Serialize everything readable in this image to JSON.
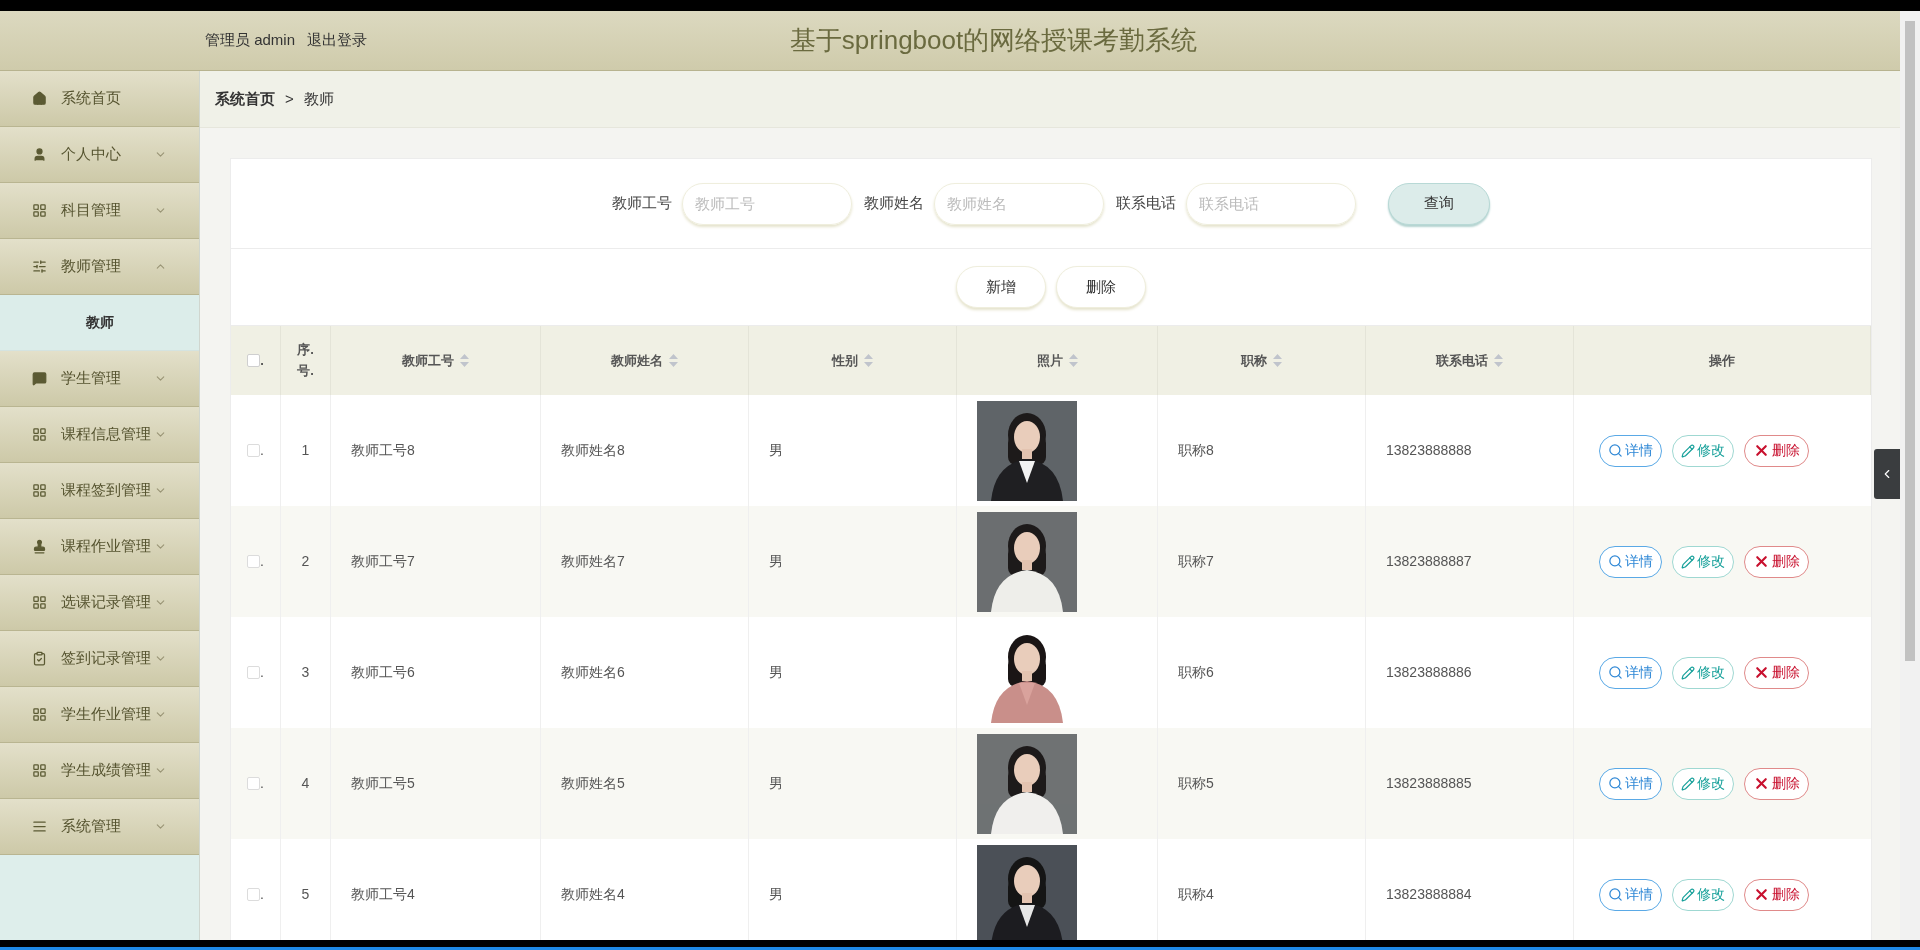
{
  "header": {
    "user_label": "管理员 admin",
    "logout": "退出登录",
    "title": "基于springboot的网络授课考勤系统"
  },
  "sidebar": {
    "items": [
      {
        "label": "系统首页",
        "kind": "link"
      },
      {
        "label": "个人中心",
        "kind": "menu",
        "expanded": false
      },
      {
        "label": "科目管理",
        "kind": "menu",
        "expanded": false
      },
      {
        "label": "教师管理",
        "kind": "menu",
        "expanded": true,
        "children": [
          {
            "label": "教师",
            "selected": true
          }
        ]
      },
      {
        "label": "学生管理",
        "kind": "menu",
        "expanded": false
      },
      {
        "label": "课程信息管理",
        "kind": "menu",
        "expanded": false
      },
      {
        "label": "课程签到管理",
        "kind": "menu",
        "expanded": false
      },
      {
        "label": "课程作业管理",
        "kind": "menu",
        "expanded": false
      },
      {
        "label": "选课记录管理",
        "kind": "menu",
        "expanded": false
      },
      {
        "label": "签到记录管理",
        "kind": "menu",
        "expanded": false
      },
      {
        "label": "学生作业管理",
        "kind": "menu",
        "expanded": false
      },
      {
        "label": "学生成绩管理",
        "kind": "menu",
        "expanded": false
      },
      {
        "label": "系统管理",
        "kind": "menu",
        "expanded": false
      }
    ]
  },
  "breadcrumb": [
    "系统首页",
    ">",
    "教师"
  ],
  "search": {
    "fields": [
      {
        "label": "教师工号",
        "placeholder": "教师工号"
      },
      {
        "label": "教师姓名",
        "placeholder": "教师姓名"
      },
      {
        "label": "联系电话",
        "placeholder": "联系电话"
      }
    ],
    "button": "查询"
  },
  "toolbar": [
    "新增",
    "删除"
  ],
  "table": {
    "header_checkbox": {
      "checked": false,
      "mark": "."
    },
    "columns": [
      {
        "label": "序.号.",
        "sortable": false
      },
      {
        "label": "教师工号",
        "sortable": true
      },
      {
        "label": "教师姓名",
        "sortable": true
      },
      {
        "label": "性别",
        "sortable": true
      },
      {
        "label": "照片",
        "sortable": true
      },
      {
        "label": "职称",
        "sortable": true
      },
      {
        "label": "联系电话",
        "sortable": true
      },
      {
        "label": "操作",
        "sortable": false
      }
    ],
    "rows": [
      {
        "checked": false,
        "mark": ".",
        "seq": "1",
        "id": "教师工号8",
        "name": "教师姓名8",
        "gender": "男",
        "title": "职称8",
        "phone": "13823888888",
        "actions": [
          {
            "kind": "detail",
            "label": "详情"
          },
          {
            "kind": "edit",
            "label": "修改"
          },
          {
            "kind": "delete",
            "label": "删除"
          }
        ]
      },
      {
        "checked": false,
        "mark": ".",
        "seq": "2",
        "id": "教师工号7",
        "name": "教师姓名7",
        "gender": "男",
        "title": "职称7",
        "phone": "13823888887",
        "actions": [
          {
            "kind": "detail",
            "label": "详情"
          },
          {
            "kind": "edit",
            "label": "修改"
          },
          {
            "kind": "delete",
            "label": "删除"
          }
        ]
      },
      {
        "checked": false,
        "mark": ".",
        "seq": "3",
        "id": "教师工号6",
        "name": "教师姓名6",
        "gender": "男",
        "title": "职称6",
        "phone": "13823888886",
        "actions": [
          {
            "kind": "detail",
            "label": "详情"
          },
          {
            "kind": "edit",
            "label": "修改"
          },
          {
            "kind": "delete",
            "label": "删除"
          }
        ]
      },
      {
        "checked": false,
        "mark": ".",
        "seq": "4",
        "id": "教师工号5",
        "name": "教师姓名5",
        "gender": "男",
        "title": "职称5",
        "phone": "13823888885",
        "actions": [
          {
            "kind": "detail",
            "label": "详情"
          },
          {
            "kind": "edit",
            "label": "修改"
          },
          {
            "kind": "delete",
            "label": "删除"
          }
        ]
      },
      {
        "checked": false,
        "mark": ".",
        "seq": "5",
        "id": "教师工号4",
        "name": "教师姓名4",
        "gender": "男",
        "title": "职称4",
        "phone": "13823888884",
        "actions": [
          {
            "kind": "detail",
            "label": "详情"
          },
          {
            "kind": "edit",
            "label": "修改"
          },
          {
            "kind": "delete",
            "label": "删除"
          }
        ]
      }
    ]
  }
}
